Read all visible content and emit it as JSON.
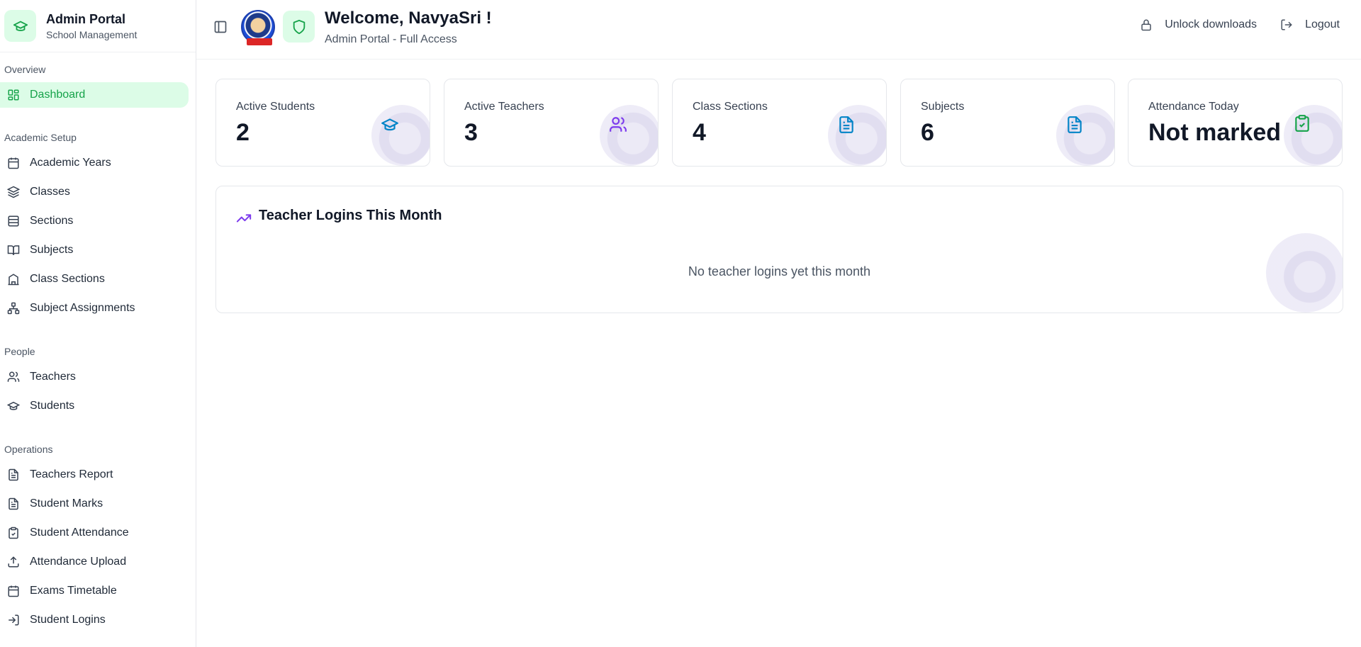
{
  "brand": {
    "title": "Admin Portal",
    "subtitle": "School Management"
  },
  "nav": {
    "groups": [
      {
        "label": "Overview",
        "items": [
          {
            "label": "Dashboard",
            "icon": "dashboard-icon",
            "active": true
          }
        ]
      },
      {
        "label": "Academic Setup",
        "items": [
          {
            "label": "Academic Years",
            "icon": "calendar-icon"
          },
          {
            "label": "Classes",
            "icon": "layers-icon"
          },
          {
            "label": "Sections",
            "icon": "rows-icon"
          },
          {
            "label": "Subjects",
            "icon": "book-open-icon"
          },
          {
            "label": "Class Sections",
            "icon": "school-icon"
          },
          {
            "label": "Subject Assignments",
            "icon": "network-icon"
          }
        ]
      },
      {
        "label": "People",
        "items": [
          {
            "label": "Teachers",
            "icon": "users-icon"
          },
          {
            "label": "Students",
            "icon": "graduation-cap-icon"
          }
        ]
      },
      {
        "label": "Operations",
        "items": [
          {
            "label": "Teachers Report",
            "icon": "file-text-icon"
          },
          {
            "label": "Student Marks",
            "icon": "file-text-icon"
          },
          {
            "label": "Student Attendance",
            "icon": "clipboard-check-icon"
          },
          {
            "label": "Attendance Upload",
            "icon": "upload-icon"
          },
          {
            "label": "Exams Timetable",
            "icon": "calendar-icon"
          },
          {
            "label": "Student Logins",
            "icon": "log-in-icon"
          }
        ]
      }
    ]
  },
  "header": {
    "welcome": "Welcome, NavyaSri !",
    "subtitle": "Admin Portal - Full Access",
    "unlock_label": "Unlock downloads",
    "logout_label": "Logout"
  },
  "stats": [
    {
      "label": "Active Students",
      "value": "2",
      "icon": "graduation-cap-icon",
      "color": "#0284c7"
    },
    {
      "label": "Active Teachers",
      "value": "3",
      "icon": "users-icon",
      "color": "#7c3aed"
    },
    {
      "label": "Class Sections",
      "value": "4",
      "icon": "file-text-icon",
      "color": "#0284c7"
    },
    {
      "label": "Subjects",
      "value": "6",
      "icon": "file-text-icon",
      "color": "#0284c7"
    },
    {
      "label": "Attendance Today",
      "value": "Not marked",
      "icon": "clipboard-check-icon",
      "color": "#16a34a"
    }
  ],
  "logins": {
    "title": "Teacher Logins This Month",
    "empty": "No teacher logins yet this month",
    "icon": "trending-up-icon"
  },
  "colors": {
    "accent": "#16a34a",
    "accent_bg": "#dcfce7",
    "purple": "#7c3aed"
  }
}
